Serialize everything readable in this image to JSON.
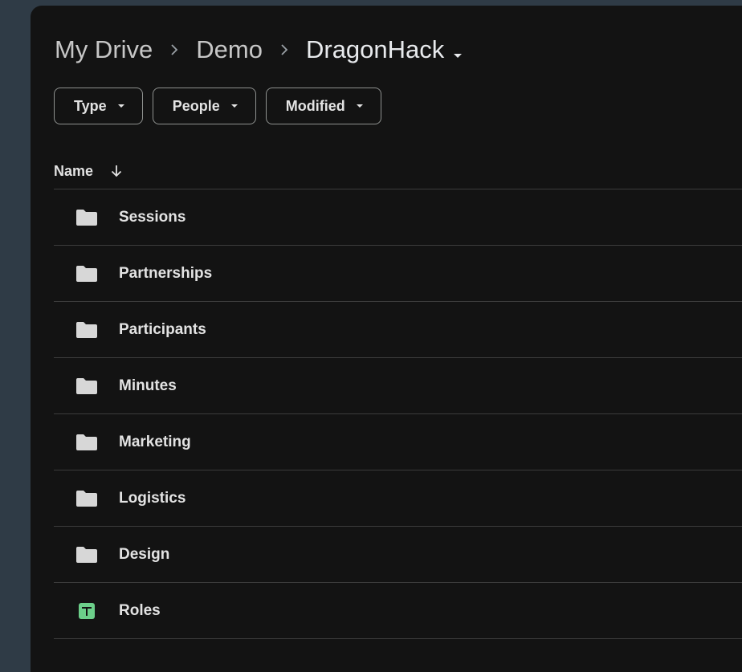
{
  "breadcrumb": {
    "items": [
      "My Drive",
      "Demo"
    ],
    "separator": ">",
    "current": "DragonHack"
  },
  "filters": [
    {
      "label": "Type"
    },
    {
      "label": "People"
    },
    {
      "label": "Modified"
    }
  ],
  "list_header": {
    "name_label": "Name",
    "sort_icon": "arrow-down-icon"
  },
  "files": [
    {
      "name": "Sessions",
      "icon": "folder-icon"
    },
    {
      "name": "Partnerships",
      "icon": "folder-icon"
    },
    {
      "name": "Participants",
      "icon": "folder-icon"
    },
    {
      "name": "Minutes",
      "icon": "folder-icon"
    },
    {
      "name": "Marketing",
      "icon": "folder-icon"
    },
    {
      "name": "Logistics",
      "icon": "folder-icon"
    },
    {
      "name": "Design",
      "icon": "folder-icon"
    },
    {
      "name": "Roles",
      "icon": "google-sheets-icon"
    }
  ],
  "colors": {
    "background": "#131313",
    "outer_background": "#2f3b46",
    "folder_icon": "#d7d7d7",
    "sheets_icon": "#6ccf8a",
    "divider": "#3c3c3c"
  }
}
